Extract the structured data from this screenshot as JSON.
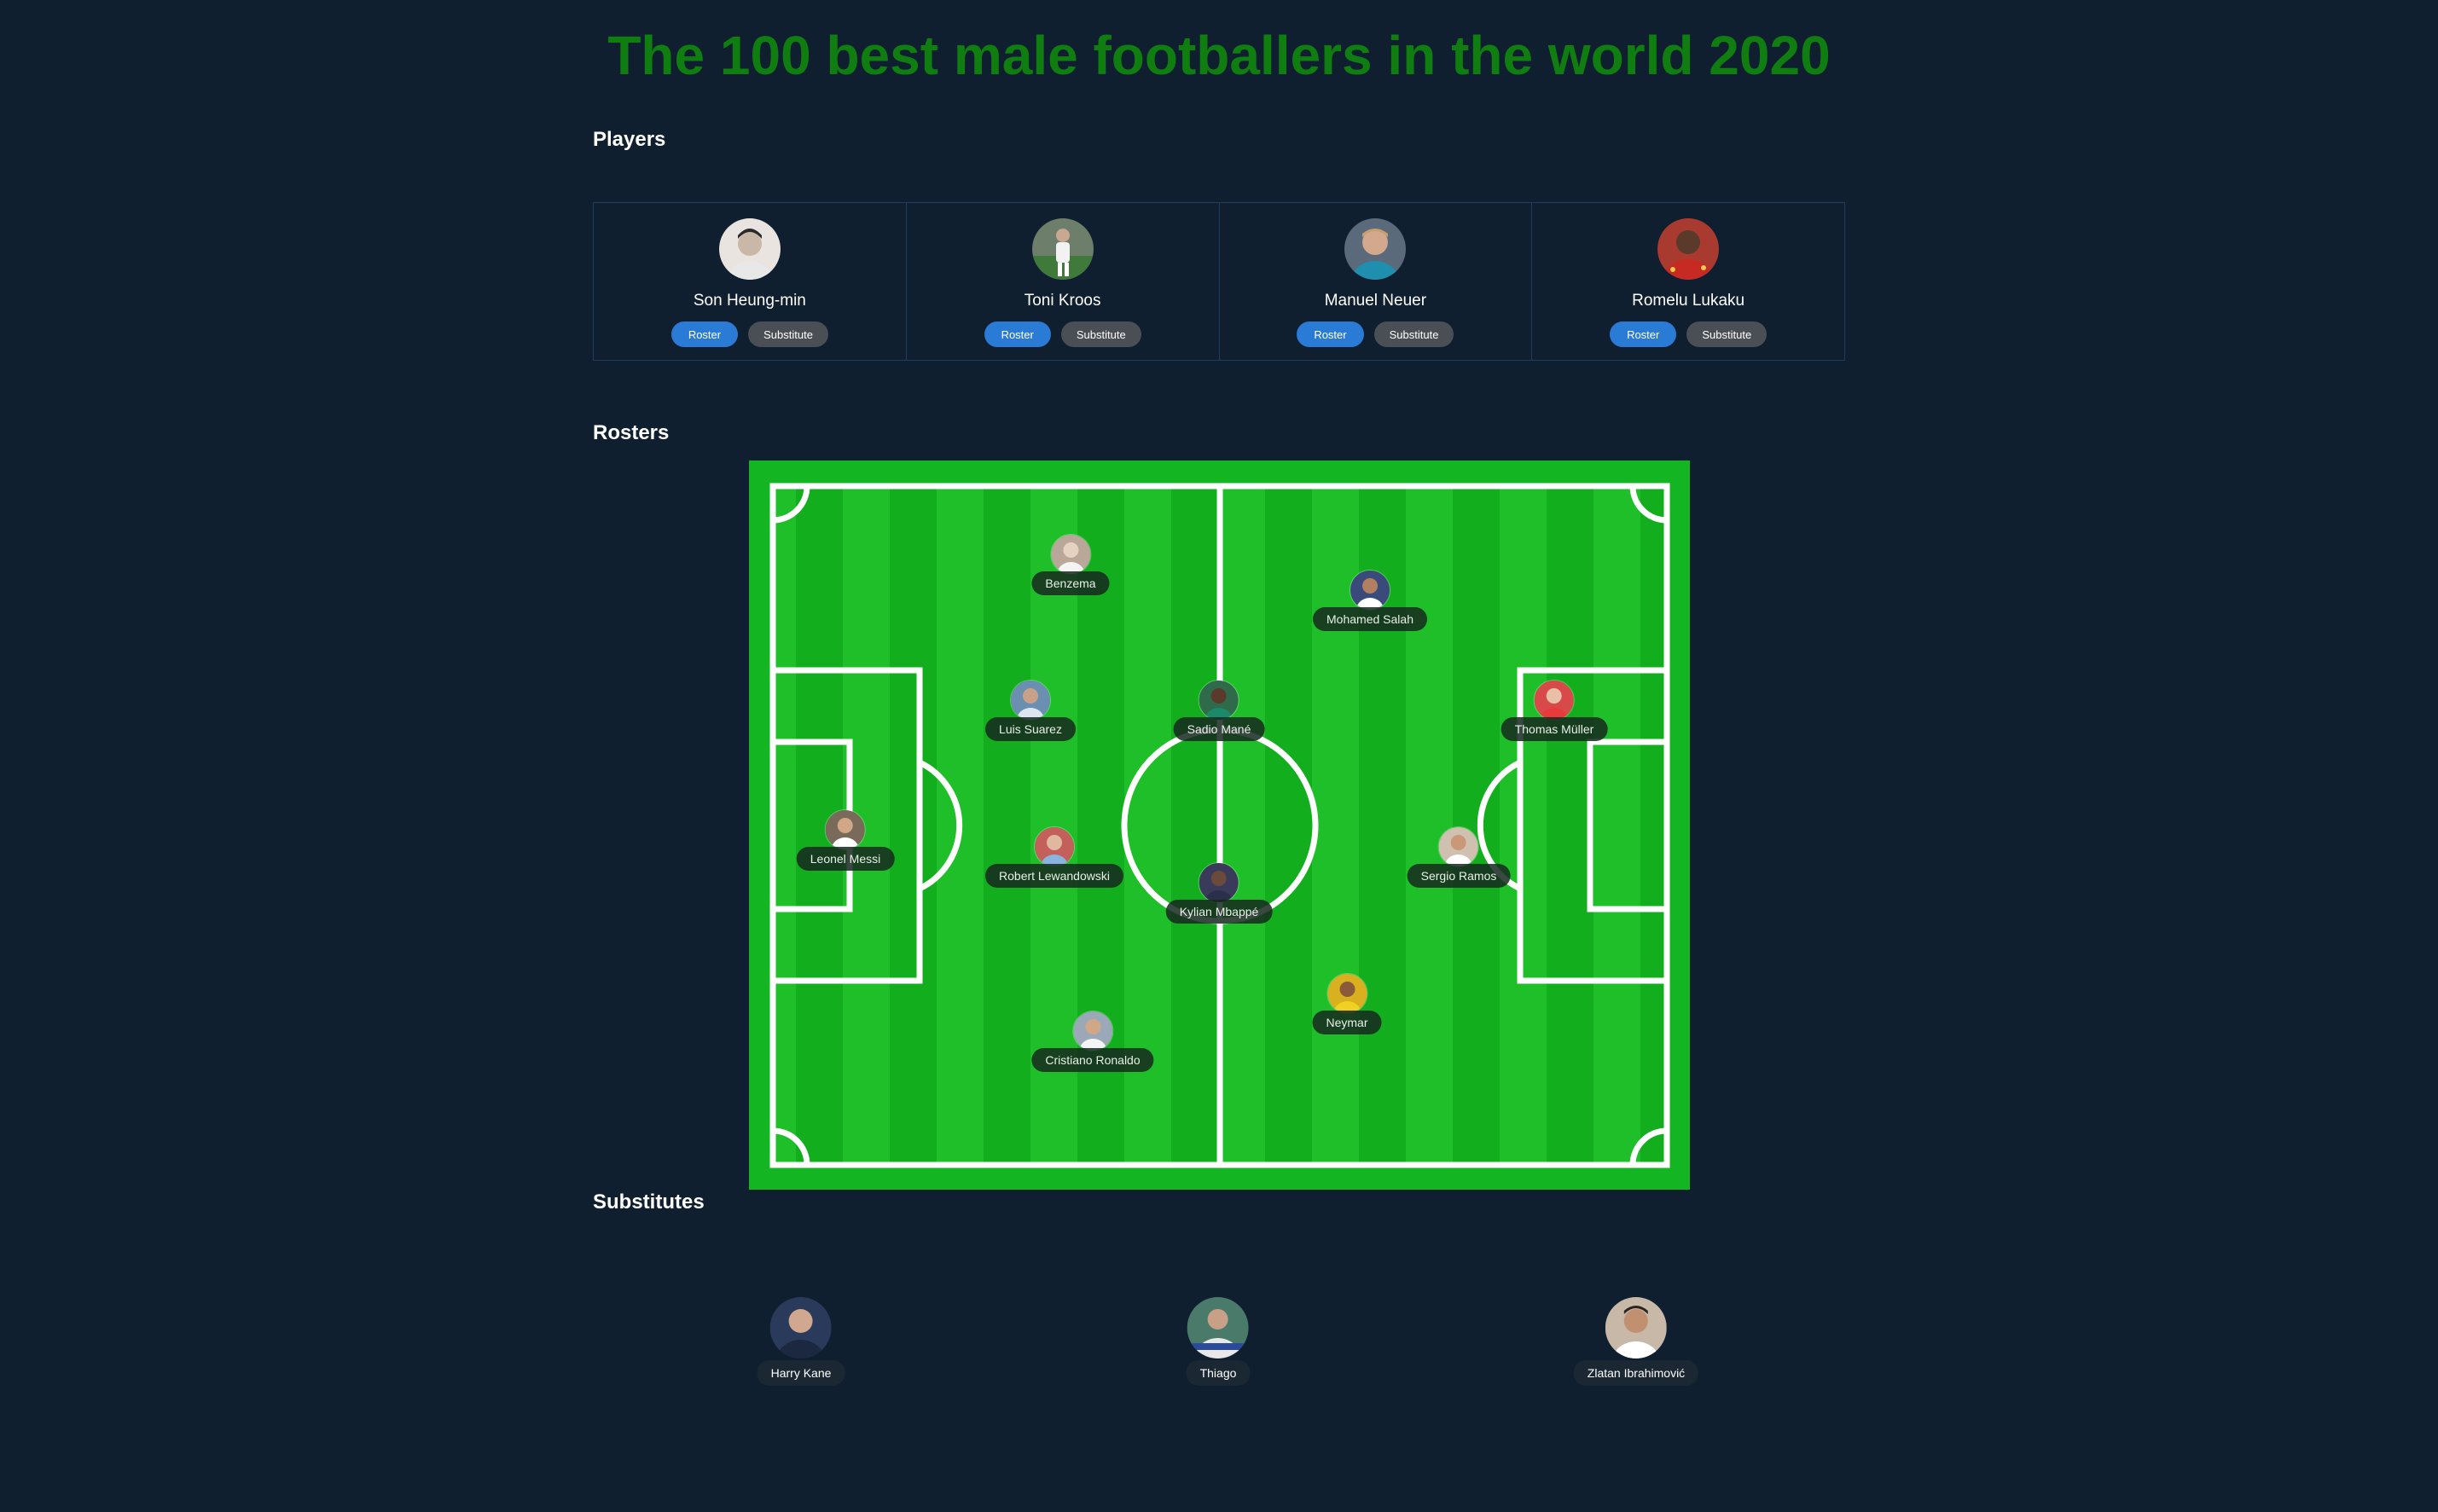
{
  "page": {
    "title": "The 100 best male footballers in the world 2020"
  },
  "sections": {
    "players": "Players",
    "rosters": "Rosters",
    "substitutes": "Substitutes"
  },
  "colors": {
    "background": "#0f1f30",
    "title": "#0f7d0f",
    "roster_button": "#2a7bd6",
    "substitute_button": "#4a4f55",
    "pitch_light": "#1fbf2a",
    "pitch_dark": "#12b01e",
    "pitch_lines": "#ffffff"
  },
  "player_cards": [
    {
      "name": "Son Heung-min",
      "roster_label": "Roster",
      "substitute_label": "Substitute",
      "avatar_color": "#c9b8a8"
    },
    {
      "name": "Toni Kroos",
      "roster_label": "Roster",
      "substitute_label": "Substitute",
      "avatar_color": "#8a9a7a"
    },
    {
      "name": "Manuel Neuer",
      "roster_label": "Roster",
      "substitute_label": "Substitute",
      "avatar_color": "#4a7f9a"
    },
    {
      "name": "Romelu Lukaku",
      "roster_label": "Roster",
      "substitute_label": "Substitute",
      "avatar_color": "#b7352c"
    }
  ],
  "roster": [
    {
      "name": "Benzema",
      "avatar_color": "#b9a89a"
    },
    {
      "name": "Mohamed Salah",
      "avatar_color": "#3a4a7a"
    },
    {
      "name": "Luis Suarez",
      "avatar_color": "#6b8fb0"
    },
    {
      "name": "Sadio Mané",
      "avatar_color": "#2f6b4a"
    },
    {
      "name": "Thomas Müller",
      "avatar_color": "#d84a4a"
    },
    {
      "name": "Leonel Messi",
      "avatar_color": "#7a6a5a"
    },
    {
      "name": "Robert Lewandowski",
      "avatar_color": "#c4605a"
    },
    {
      "name": "Kylian Mbappé",
      "avatar_color": "#3a3a5a"
    },
    {
      "name": "Sergio Ramos",
      "avatar_color": "#d0c0b0"
    },
    {
      "name": "Neymar",
      "avatar_color": "#d8b020"
    },
    {
      "name": "Cristiano Ronaldo",
      "avatar_color": "#9aa8b8"
    }
  ],
  "substitutes": [
    {
      "name": "Harry Kane",
      "avatar_color": "#2a3a5a"
    },
    {
      "name": "Thiago",
      "avatar_color": "#4a7a6a"
    },
    {
      "name": "Zlatan Ibrahimović",
      "avatar_color": "#c8b8a8"
    }
  ]
}
